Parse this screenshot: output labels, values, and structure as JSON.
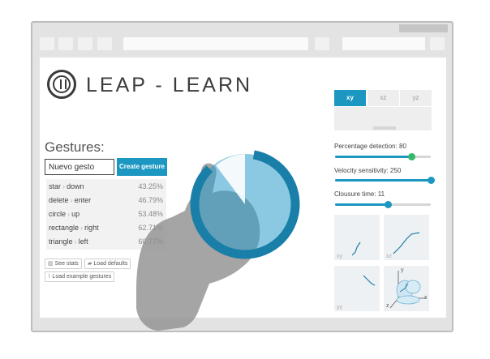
{
  "brand": "LEAP - LEARN",
  "gestures": {
    "title": "Gestures:",
    "input_value": "Nuevo gesto",
    "create_label": "Create gesture",
    "items": [
      {
        "from": "star",
        "to": "down",
        "pct": "43.25%"
      },
      {
        "from": "delete",
        "to": "enter",
        "pct": "46.79%"
      },
      {
        "from": "circle",
        "to": "up",
        "pct": "53.48%"
      },
      {
        "from": "rectangle",
        "to": "right",
        "pct": "62.71%"
      },
      {
        "from": "triangle",
        "to": "left",
        "pct": "60.77%"
      }
    ],
    "see_stats": "See stats",
    "load_defaults": "Load defaults",
    "load_examples": "Load example gestures"
  },
  "plane_tabs": [
    "xy",
    "xz",
    "yz"
  ],
  "active_tab": "xy",
  "sliders": [
    {
      "label": "Percentage detection: 80",
      "value": 0.8
    },
    {
      "label": "Velocity sensitivity: 250",
      "value": 1.0
    },
    {
      "label": "Clousure time: 11",
      "value": 0.55
    }
  ],
  "thumbnails": {
    "xy": "xy",
    "xz": "xz",
    "yz": "yz",
    "axis_x": "x",
    "axis_y": "y",
    "axis_z": "z"
  },
  "colors": {
    "accent": "#1b97c2",
    "slider_knob_detection": "#34b86a",
    "frame": "#e3e3e3"
  },
  "icons": {
    "see_stats": "bar-chart-icon",
    "load_defaults": "folder-icon",
    "load_examples": "paperclip-icon",
    "arrow": "chevron-right-icon"
  }
}
